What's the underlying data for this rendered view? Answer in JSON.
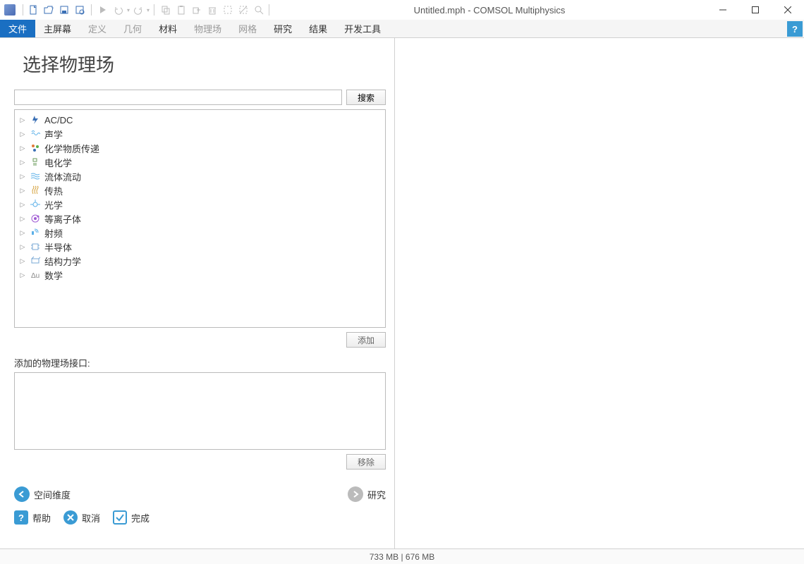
{
  "window": {
    "title": "Untitled.mph - COMSOL Multiphysics"
  },
  "qat": {
    "items": [
      {
        "name": "new-icon",
        "disabled": false
      },
      {
        "name": "open-icon",
        "disabled": false
      },
      {
        "name": "save-icon",
        "disabled": false
      },
      {
        "name": "save-as-icon",
        "disabled": false
      },
      {
        "name": "run-icon",
        "disabled": true
      },
      {
        "name": "undo-icon",
        "disabled": true
      },
      {
        "name": "redo-icon",
        "disabled": true
      },
      {
        "name": "copy-icon",
        "disabled": true
      },
      {
        "name": "paste-icon",
        "disabled": true
      },
      {
        "name": "duplicate-icon",
        "disabled": true
      },
      {
        "name": "delete-icon",
        "disabled": true
      },
      {
        "name": "select-icon",
        "disabled": true
      },
      {
        "name": "deselect-icon",
        "disabled": true
      },
      {
        "name": "zoom-icon",
        "disabled": true
      }
    ]
  },
  "menubar": {
    "items": [
      {
        "label": "文件",
        "state": "active"
      },
      {
        "label": "主屏幕",
        "state": "normal"
      },
      {
        "label": "定义",
        "state": "dim"
      },
      {
        "label": "几何",
        "state": "dim"
      },
      {
        "label": "材料",
        "state": "normal"
      },
      {
        "label": "物理场",
        "state": "dim"
      },
      {
        "label": "网格",
        "state": "dim"
      },
      {
        "label": "研究",
        "state": "normal"
      },
      {
        "label": "结果",
        "state": "normal"
      },
      {
        "label": "开发工具",
        "state": "normal"
      }
    ],
    "help": "?"
  },
  "page": {
    "title": "选择物理场",
    "search_placeholder": "",
    "search_button": "搜索",
    "add_button": "添加",
    "remove_button": "移除",
    "added_label": "添加的物理场接口:"
  },
  "tree": [
    {
      "icon": "acdc",
      "color": "#3a6fb5",
      "label": "AC/DC"
    },
    {
      "icon": "acoustic",
      "color": "#5bb0e8",
      "label": "声学"
    },
    {
      "icon": "chem",
      "color": "#e07b3a",
      "label": "化学物质传递"
    },
    {
      "icon": "electrochem",
      "color": "#6a9b5a",
      "label": "电化学"
    },
    {
      "icon": "fluid",
      "color": "#5bb0e8",
      "label": "流体流动"
    },
    {
      "icon": "heat",
      "color": "#d4a03a",
      "label": "传热"
    },
    {
      "icon": "optics",
      "color": "#5bb0e8",
      "label": "光学"
    },
    {
      "icon": "plasma",
      "color": "#a05bd4",
      "label": "等离子体"
    },
    {
      "icon": "rf",
      "color": "#5bb0e8",
      "label": "射频"
    },
    {
      "icon": "semi",
      "color": "#7aa8d4",
      "label": "半导体"
    },
    {
      "icon": "struct",
      "color": "#7aa8d4",
      "label": "结构力学"
    },
    {
      "icon": "math",
      "color": "#888",
      "label": "数学"
    }
  ],
  "nav": {
    "back": "空间维度",
    "forward": "研究"
  },
  "footer": {
    "help": "帮助",
    "cancel": "取消",
    "done": "完成"
  },
  "status": {
    "memory": "733 MB | 676 MB"
  }
}
